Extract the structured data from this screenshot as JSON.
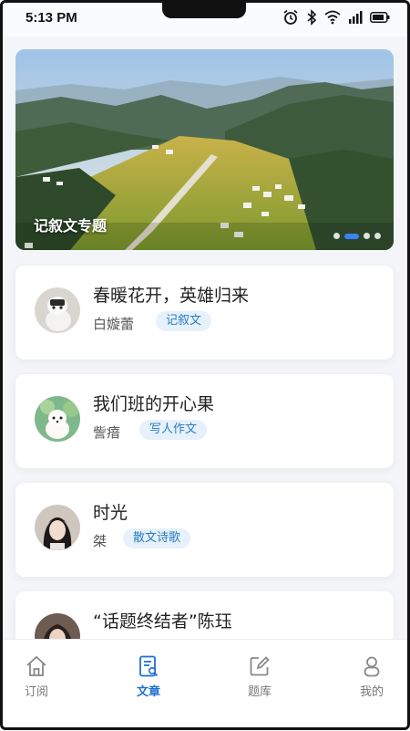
{
  "status_bar": {
    "time": "5:13 PM",
    "icons": [
      "alarm-icon",
      "bluetooth-icon",
      "wifi-icon",
      "signal-icon",
      "battery-icon"
    ]
  },
  "banner": {
    "caption": "记叙文专题",
    "dots": 4,
    "active_dot": 1
  },
  "articles": [
    {
      "title": "春暖花开，英雄归来",
      "author": "白嫙蕾",
      "tag": "记叙文"
    },
    {
      "title": "我们班的开心果",
      "author": "訾瘖",
      "tag": "写人作文"
    },
    {
      "title": "时光",
      "author": "桀",
      "tag": "散文诗歌"
    },
    {
      "title": "“话题终结者”陈珏",
      "author": "",
      "tag": ""
    }
  ],
  "tabbar": {
    "items": [
      {
        "label": "订阅",
        "icon": "home-icon",
        "active": false
      },
      {
        "label": "文章",
        "icon": "article-icon",
        "active": true
      },
      {
        "label": "题库",
        "icon": "edit-icon",
        "active": false
      },
      {
        "label": "我的",
        "icon": "person-icon",
        "active": false
      }
    ]
  },
  "colors": {
    "accent": "#1f6fd1",
    "tag_bg": "#e6f1fb",
    "tag_text": "#2a7fc1"
  }
}
